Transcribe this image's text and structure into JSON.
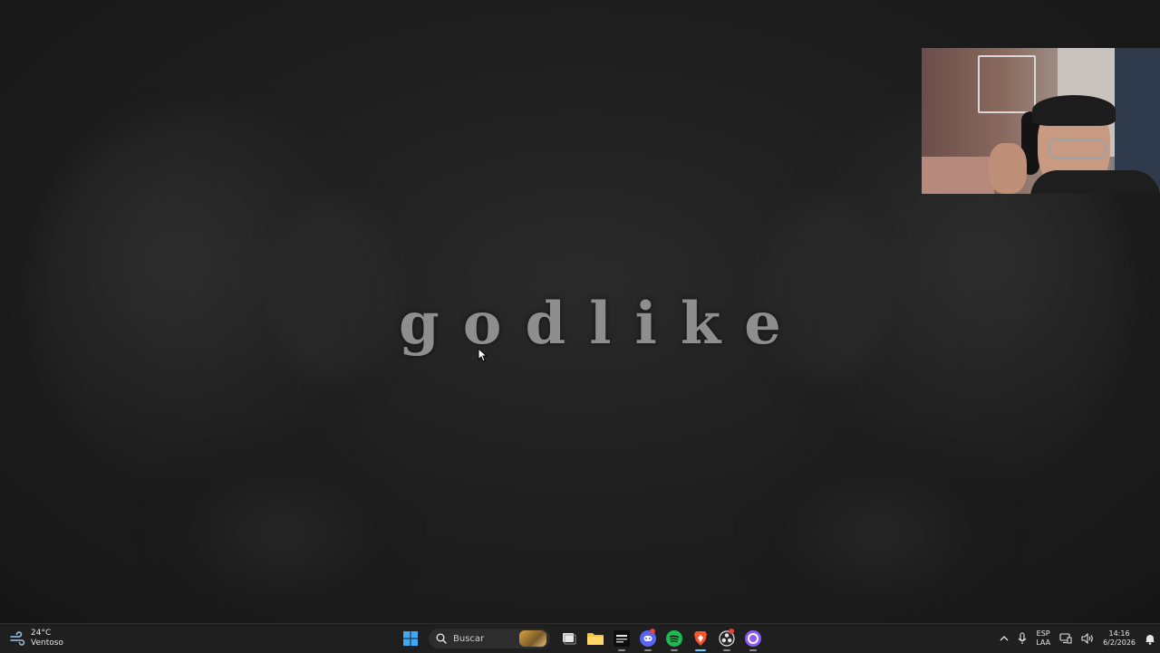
{
  "desktop": {
    "title": "godlike"
  },
  "taskbar": {
    "weather": {
      "temp": "24°C",
      "condition": "Ventoso",
      "icon": "wind-icon"
    },
    "search": {
      "placeholder": "Buscar"
    },
    "apps": [
      {
        "name": "start",
        "icon": "windows-logo-icon"
      },
      {
        "name": "search",
        "icon": "search-icon"
      },
      {
        "name": "task-view",
        "icon": "task-view-icon"
      },
      {
        "name": "file-explorer",
        "icon": "folder-icon"
      },
      {
        "name": "cod",
        "icon": "game-icon"
      },
      {
        "name": "discord",
        "icon": "discord-icon"
      },
      {
        "name": "spotify",
        "icon": "spotify-icon"
      },
      {
        "name": "brave",
        "icon": "brave-icon"
      },
      {
        "name": "obs",
        "icon": "obs-icon"
      },
      {
        "name": "other",
        "icon": "circle-app-icon"
      }
    ],
    "tray": {
      "language_top": "ESP",
      "language_bottom": "LAA",
      "time": "14:16",
      "date": "6/2/2026"
    }
  },
  "colors": {
    "title": "#8e8e8e",
    "taskbar_bg": "#1f1f1f",
    "accent": "#60cdff"
  }
}
